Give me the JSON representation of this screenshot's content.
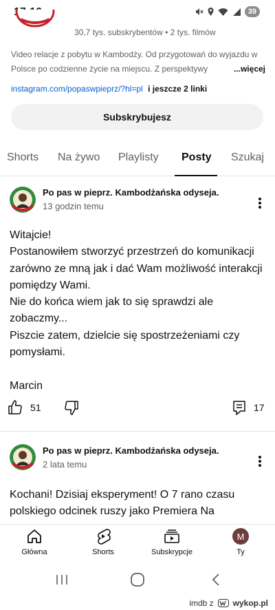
{
  "status_bar": {
    "time": "17:16",
    "battery": "39",
    "icons": [
      "mute-icon",
      "location-icon",
      "wifi-icon",
      "signal-icon",
      "battery-icon"
    ]
  },
  "channel": {
    "meta": "30,7 tys. subskrybentów • 2 tys. filmów",
    "description": "Video relacje z pobytu w Kambodży. Od przygotowań do wyjazdu w Polsce po codzienne życie na miejscu. Z perspektywy",
    "more_label": "...więcej",
    "link": "instagram.com/popaswpieprz/?hl=pl",
    "extra_links": "i jeszcze 2 linki",
    "subscribe_label": "Subskrybujesz"
  },
  "tabs": [
    {
      "label": "Shorts",
      "active": false
    },
    {
      "label": "Na żywo",
      "active": false
    },
    {
      "label": "Playlisty",
      "active": false
    },
    {
      "label": "Posty",
      "active": true
    },
    {
      "label": "Szukaj",
      "active": false
    }
  ],
  "posts": [
    {
      "author": "Po pas w pieprz. Kambodżańska odyseja.",
      "time": "13 godzin temu",
      "body": [
        "Witajcie!",
        "Postanowiłem stworzyć przestrzeń do komunikacji zarówno ze mną jak i dać Wam możliwość interakcji pomiędzy Wami.",
        "Nie do końca wiem jak to się sprawdzi ale zobaczmy...",
        "Piszcie zatem, dzielcie się spostrzeżeniami czy pomysłami.",
        "",
        "Marcin"
      ],
      "likes": "51",
      "comments": "17"
    },
    {
      "author": "Po pas w pieprz. Kambodżańska odyseja.",
      "time": "2 lata temu",
      "body": [
        "Kochani! Dzisiaj eksperyment! O 7 rano czasu polskiego odcinek ruszy jako Premiera Na"
      ]
    }
  ],
  "bottom_nav": [
    {
      "label": "Główna",
      "icon": "home-icon"
    },
    {
      "label": "Shorts",
      "icon": "shorts-icon"
    },
    {
      "label": "Subskrypcje",
      "icon": "subscriptions-icon"
    },
    {
      "label": "Ty",
      "icon": "profile-avatar",
      "avatar_letter": "M"
    }
  ],
  "watermark": {
    "text": "imdb z",
    "logo_text": "wykop.pl"
  },
  "colors": {
    "link": "#065fd4",
    "secondary_text": "#606060",
    "profile_avatar": "#6d3c3c",
    "button_bg": "#f2f2f2"
  }
}
